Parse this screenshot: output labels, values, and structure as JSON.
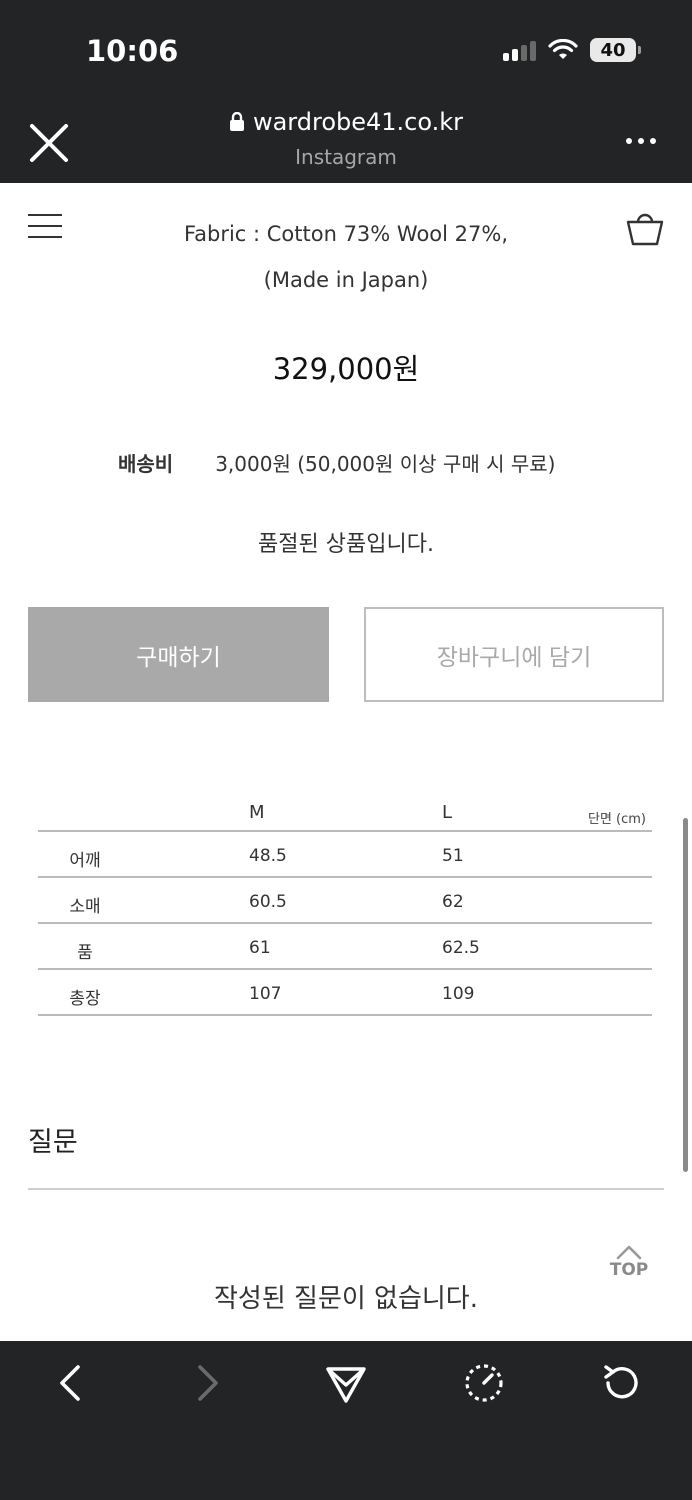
{
  "status_bar": {
    "time": "10:06",
    "battery": "40"
  },
  "browser": {
    "url": "wardrobe41.co.kr",
    "source": "Instagram"
  },
  "product": {
    "fabric_line1": "Fabric : Cotton 73% Wool 27%,",
    "fabric_line2": "(Made in Japan)",
    "price": "329,000원",
    "shipping_label": "배송비",
    "shipping_value": "3,000원 (50,000원 이상 구매 시 무료)",
    "soldout_text": "품절된 상품입니다.",
    "buy_label": "구매하기",
    "cart_label": "장바구니에 담기"
  },
  "size_table": {
    "columns": [
      "M",
      "L"
    ],
    "unit": "단면 (cm)",
    "rows": [
      {
        "label": "어깨",
        "m": "48.5",
        "l": "51"
      },
      {
        "label": "소매",
        "m": "60.5",
        "l": "62"
      },
      {
        "label": "품",
        "m": "61",
        "l": "62.5"
      },
      {
        "label": "총장",
        "m": "107",
        "l": "109"
      }
    ]
  },
  "qna": {
    "title": "질문",
    "empty_text": "작성된 질문이 없습니다."
  },
  "top_button": "TOP",
  "colors": {
    "chrome": "#222426",
    "button_gray": "#a9a9a9"
  }
}
